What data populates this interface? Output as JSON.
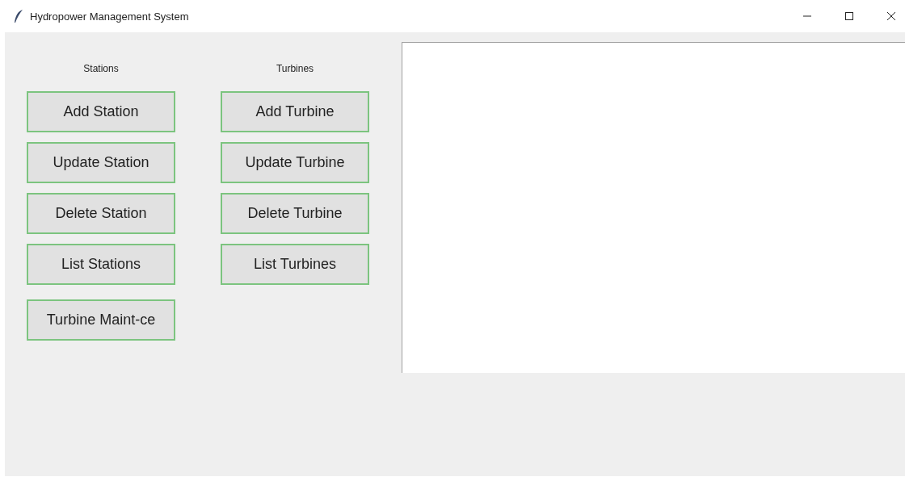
{
  "window": {
    "title": "Hydropower Management System"
  },
  "columns": [
    {
      "heading": "Stations",
      "buttons": [
        "Add Station",
        "Update Station",
        "Delete Station",
        "List Stations",
        "Turbine Maint-ce"
      ]
    },
    {
      "heading": "Turbines",
      "buttons": [
        "Add Turbine",
        "Update Turbine",
        "Delete Turbine",
        "List Turbines"
      ]
    }
  ]
}
